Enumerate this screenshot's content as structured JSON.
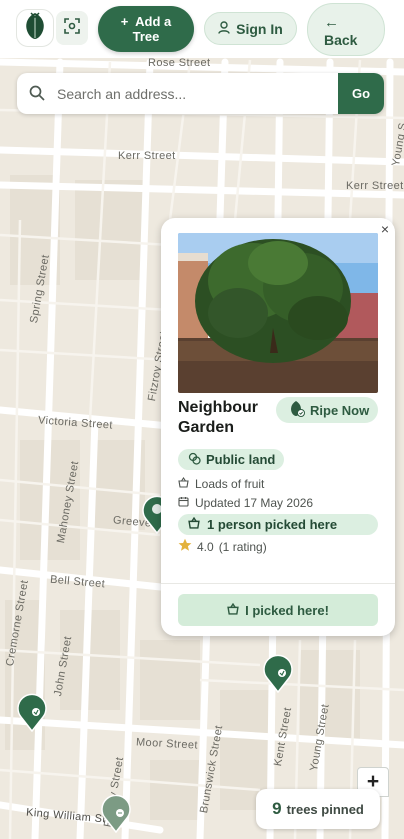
{
  "header": {
    "add_tree_label": "Add a Tree",
    "add_tree_plus": "+",
    "sign_in_label": "Sign In",
    "back_label": "Back",
    "back_arrow": "←"
  },
  "search": {
    "placeholder": "Search an address...",
    "go_label": "Go"
  },
  "map": {
    "streets": {
      "rose": "Rose Street",
      "kerr_1": "Kerr Street",
      "kerr_2": "Kerr Street",
      "young_top": "Young S",
      "spring": "Spring Street",
      "fitzroy_top": "Fitzroy Street",
      "victoria": "Victoria Street",
      "mahoney": "Mahoney Street",
      "greeves": "Greeve",
      "bell": "Bell Street",
      "cremorne": "Cremorne Street",
      "john": "John Street",
      "moor": "Moor Street",
      "brunswick": "Brunswick Street",
      "kent": "Kent Street",
      "young_bottom": "Young Street",
      "fitzroy_bottom": "Fitzroy Street",
      "king_william": "King William St"
    }
  },
  "popup": {
    "close_glyph": "×",
    "title": "Neighbour Garden",
    "ripe_label": "Ripe Now",
    "public_label": "Public land",
    "yield_text": "Loads of fruit",
    "updated_text": "Updated 17 May 2026",
    "picked_count_text": "1 person picked here",
    "rating_value": "4.0",
    "rating_count": "(1 rating)",
    "picked_button_label": "I picked here!"
  },
  "map_controls": {
    "zoom_in_label": "+"
  },
  "counter": {
    "count": "9",
    "label": "trees pinned"
  },
  "colors": {
    "brand_green": "#2f6b4a",
    "light_green": "#dcefe1",
    "star": "#e3b23c"
  },
  "icons": {
    "logo": "tree-logo-icon",
    "scan": "scan-icon",
    "user": "user-icon",
    "search": "search-icon",
    "close": "close-icon",
    "ripe": "ripe-icon",
    "public": "public-land-icon",
    "basket": "basket-icon",
    "calendar": "calendar-icon",
    "star": "star-icon"
  }
}
